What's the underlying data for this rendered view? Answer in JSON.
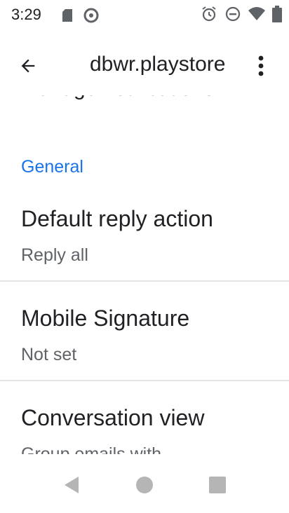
{
  "status_bar": {
    "time": "3:29",
    "left_icons": [
      "sd-card-icon",
      "sync-icon"
    ],
    "right_icons": [
      "alarm-icon",
      "do-not-disturb-icon",
      "wifi-icon",
      "battery-icon"
    ]
  },
  "app_bar": {
    "title": "dbwr.playstore",
    "back_icon": "arrow-back-icon",
    "overflow_icon": "more-vert-icon"
  },
  "content": {
    "partial_item_title": "Manage notifications",
    "section_header": "General",
    "items": [
      {
        "title": "Default reply action",
        "summary": "Reply all"
      },
      {
        "title": "Mobile Signature",
        "summary": "Not set"
      },
      {
        "title": "Conversation view",
        "summary": "Group emails with"
      }
    ]
  },
  "nav_bar": {
    "buttons": [
      "back-triangle-icon",
      "home-circle-icon",
      "recents-square-icon"
    ]
  },
  "colors": {
    "accent": "#1a73e8",
    "text_primary": "#202124",
    "text_secondary": "#5f6368",
    "nav_icon": "#b5b5b5"
  }
}
